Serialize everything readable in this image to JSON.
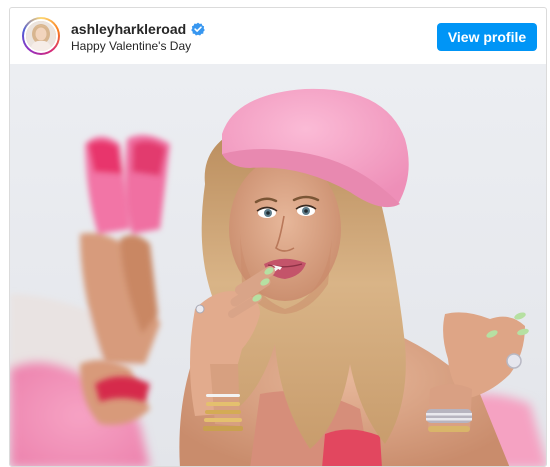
{
  "post": {
    "username": "ashleyharkleroad",
    "location": "Happy Valentine's Day",
    "view_profile_label": "View profile"
  },
  "icons": {
    "verified": "verified-badge-icon"
  },
  "colors": {
    "button": "#0095f6",
    "verified": "#3897f0",
    "beret": "#f7a6c8",
    "background": "#eef0f3"
  }
}
